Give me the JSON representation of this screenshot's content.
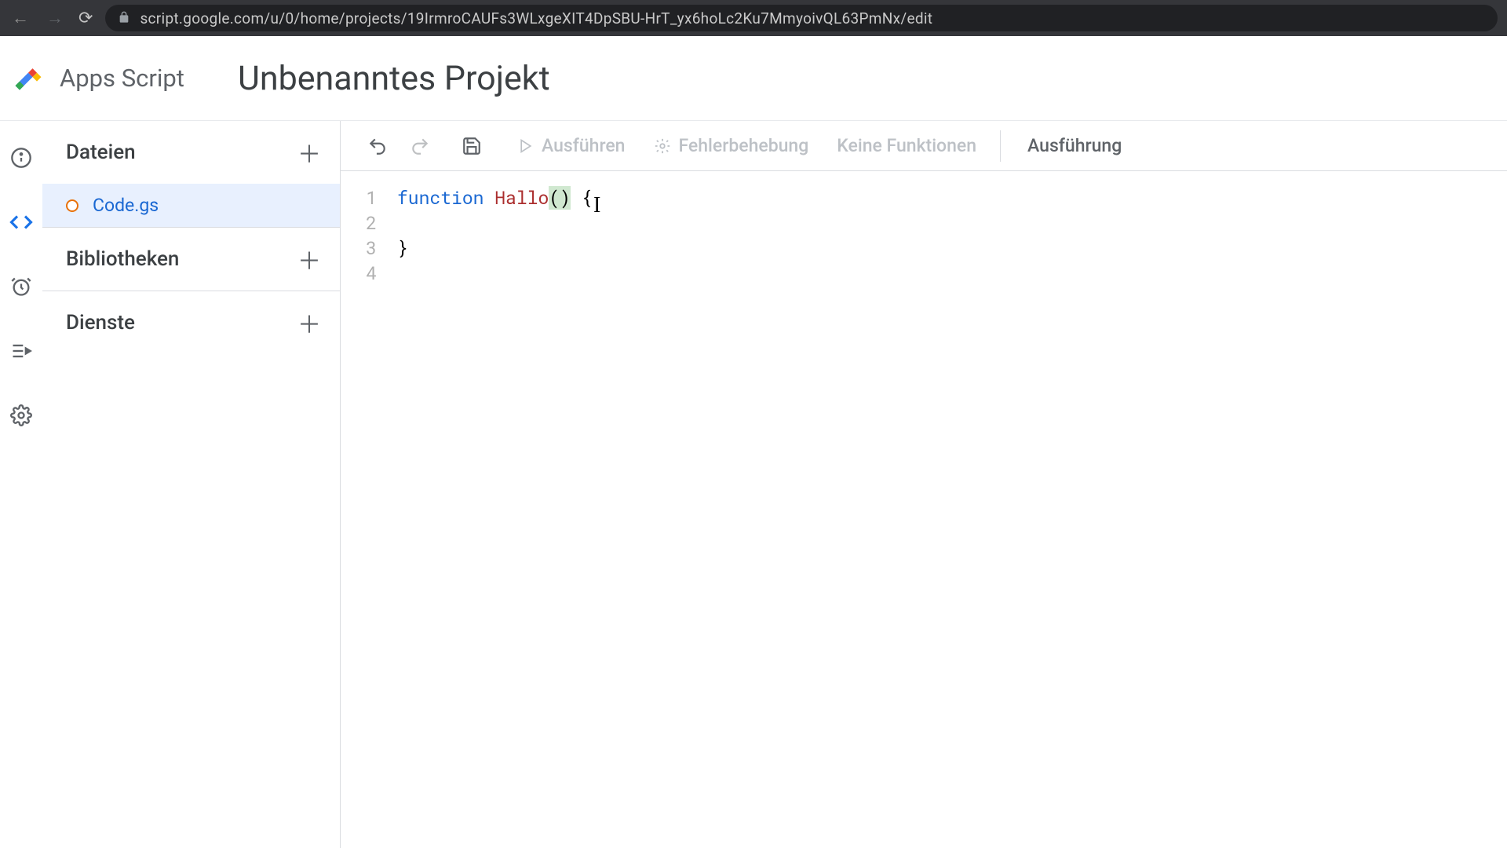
{
  "browser": {
    "url": "script.google.com/u/0/home/projects/19IrmroCAUFs3WLxgeXIT4DpSBU-HrT_yx6hoLc2Ku7MmyoivQL63PmNx/edit"
  },
  "header": {
    "product": "Apps Script",
    "project_title": "Unbenanntes Projekt"
  },
  "sidebar": {
    "files_label": "Dateien",
    "files": [
      {
        "name": "Code.gs",
        "dirty": true
      }
    ],
    "libraries_label": "Bibliotheken",
    "services_label": "Dienste"
  },
  "toolbar": {
    "run": "Ausführen",
    "debug": "Fehlerbehebung",
    "fn_selector": "Keine Funktionen",
    "exec_log": "Ausführung"
  },
  "code": {
    "lines": [
      {
        "n": "1",
        "tokens": [
          {
            "t": "function ",
            "c": "kw"
          },
          {
            "t": "Hallo",
            "c": "fn"
          },
          {
            "t": "(",
            "c": "bracket-hl"
          },
          {
            "t": ")",
            "c": "bracket-hl"
          },
          {
            "t": " {",
            "c": ""
          }
        ]
      },
      {
        "n": "2",
        "tokens": [
          {
            "t": "  ",
            "c": ""
          }
        ]
      },
      {
        "n": "3",
        "tokens": [
          {
            "t": "}",
            "c": ""
          }
        ]
      },
      {
        "n": "4",
        "tokens": [
          {
            "t": "",
            "c": ""
          }
        ]
      }
    ]
  }
}
